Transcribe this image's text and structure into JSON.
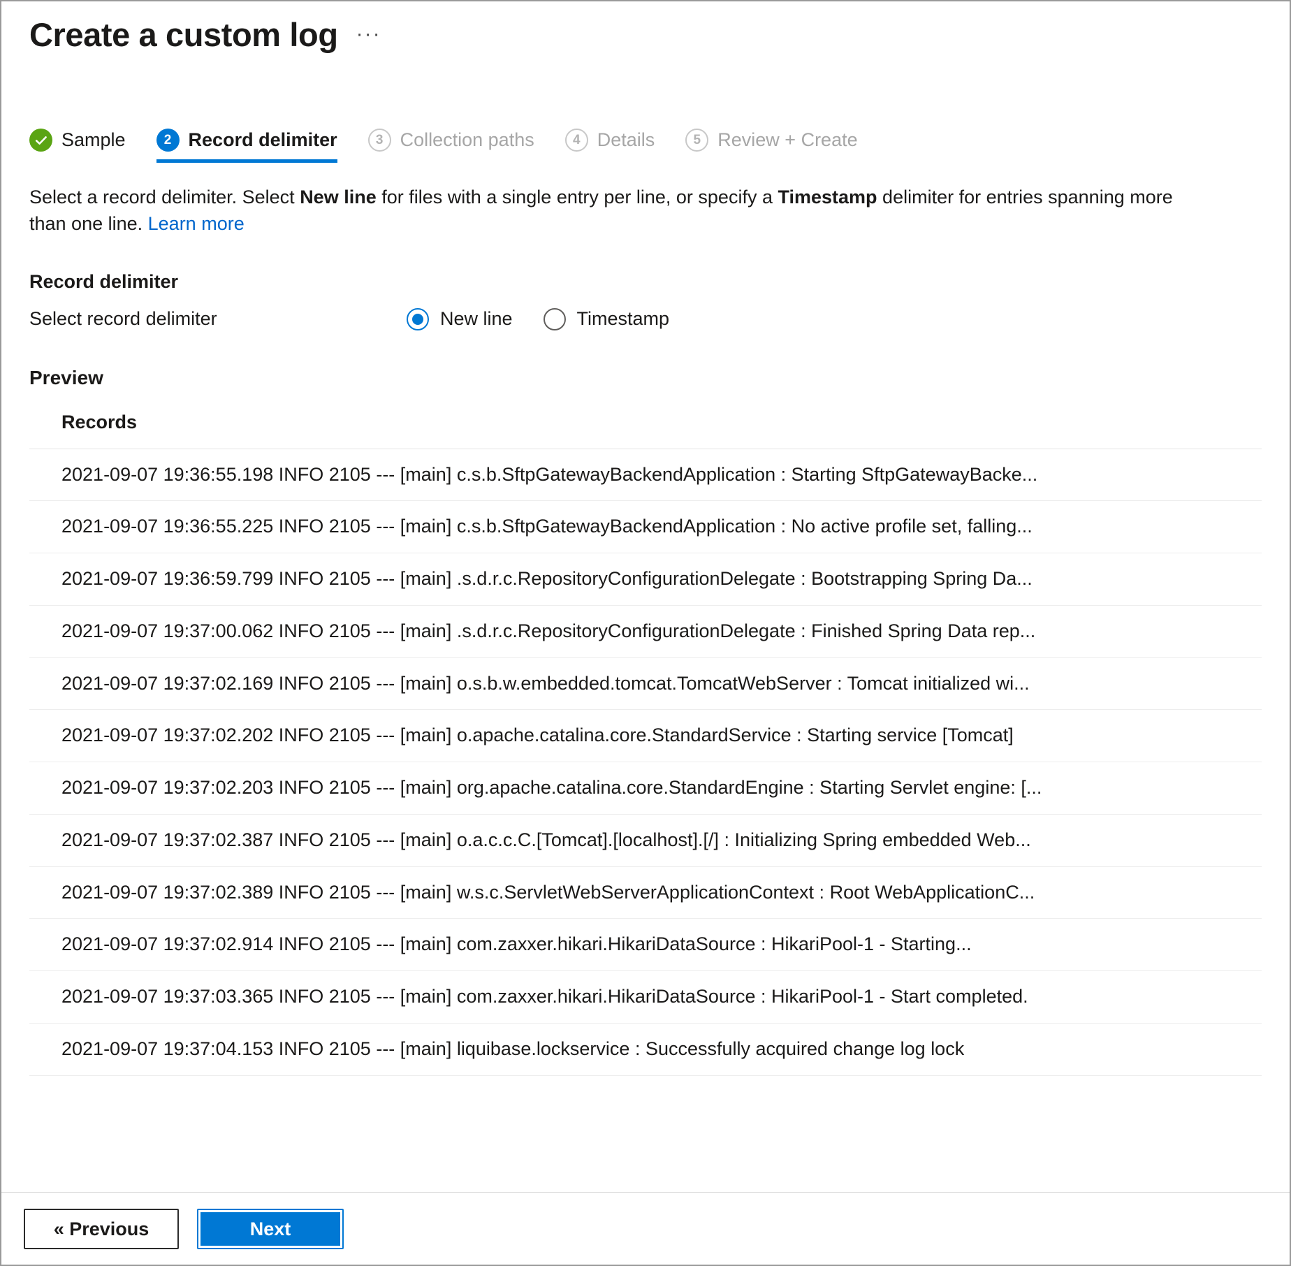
{
  "header": {
    "title": "Create a custom log",
    "more_actions": "···"
  },
  "wizard": {
    "steps": [
      {
        "badge": "✓",
        "label": "Sample",
        "state": "completed"
      },
      {
        "badge": "2",
        "label": "Record delimiter",
        "state": "active"
      },
      {
        "badge": "3",
        "label": "Collection paths",
        "state": "disabled"
      },
      {
        "badge": "4",
        "label": "Details",
        "state": "disabled"
      },
      {
        "badge": "5",
        "label": "Review + Create",
        "state": "disabled"
      }
    ]
  },
  "description": {
    "part1": "Select a record delimiter. Select ",
    "bold1": "New line",
    "part2": " for files with a single entry per line, or specify a ",
    "bold2": "Timestamp",
    "part3": " delimiter for entries spanning more than one line. ",
    "link": "Learn more"
  },
  "record_delimiter": {
    "heading": "Record delimiter",
    "field_label": "Select record delimiter",
    "options": [
      {
        "label": "New line",
        "selected": true
      },
      {
        "label": "Timestamp",
        "selected": false
      }
    ]
  },
  "preview": {
    "heading": "Preview",
    "column_header": "Records",
    "rows": [
      "2021-09-07 19:36:55.198 INFO 2105 --- [main] c.s.b.SftpGatewayBackendApplication : Starting SftpGatewayBacke...",
      "2021-09-07 19:36:55.225 INFO 2105 --- [main] c.s.b.SftpGatewayBackendApplication : No active profile set, falling...",
      "2021-09-07 19:36:59.799 INFO 2105 --- [main] .s.d.r.c.RepositoryConfigurationDelegate : Bootstrapping Spring Da...",
      "2021-09-07 19:37:00.062 INFO 2105 --- [main] .s.d.r.c.RepositoryConfigurationDelegate : Finished Spring Data rep...",
      "2021-09-07 19:37:02.169 INFO 2105 --- [main] o.s.b.w.embedded.tomcat.TomcatWebServer : Tomcat initialized wi...",
      "2021-09-07 19:37:02.202 INFO 2105 --- [main] o.apache.catalina.core.StandardService : Starting service [Tomcat]",
      "2021-09-07 19:37:02.203 INFO 2105 --- [main] org.apache.catalina.core.StandardEngine : Starting Servlet engine: [...",
      "2021-09-07 19:37:02.387 INFO 2105 --- [main] o.a.c.c.C.[Tomcat].[localhost].[/] : Initializing Spring embedded Web...",
      "2021-09-07 19:37:02.389 INFO 2105 --- [main] w.s.c.ServletWebServerApplicationContext : Root WebApplicationC...",
      "2021-09-07 19:37:02.914 INFO 2105 --- [main] com.zaxxer.hikari.HikariDataSource : HikariPool-1 - Starting...",
      "2021-09-07 19:37:03.365 INFO 2105 --- [main] com.zaxxer.hikari.HikariDataSource : HikariPool-1 - Start completed.",
      "2021-09-07 19:37:04.153 INFO 2105 --- [main] liquibase.lockservice : Successfully acquired change log lock"
    ]
  },
  "footer": {
    "previous_label": "« Previous",
    "next_label": "Next"
  },
  "colors": {
    "accent": "#0078d4",
    "success": "#5aa413",
    "link": "#0066cc",
    "text": "#1b1a19",
    "muted": "#a6a6a6"
  }
}
